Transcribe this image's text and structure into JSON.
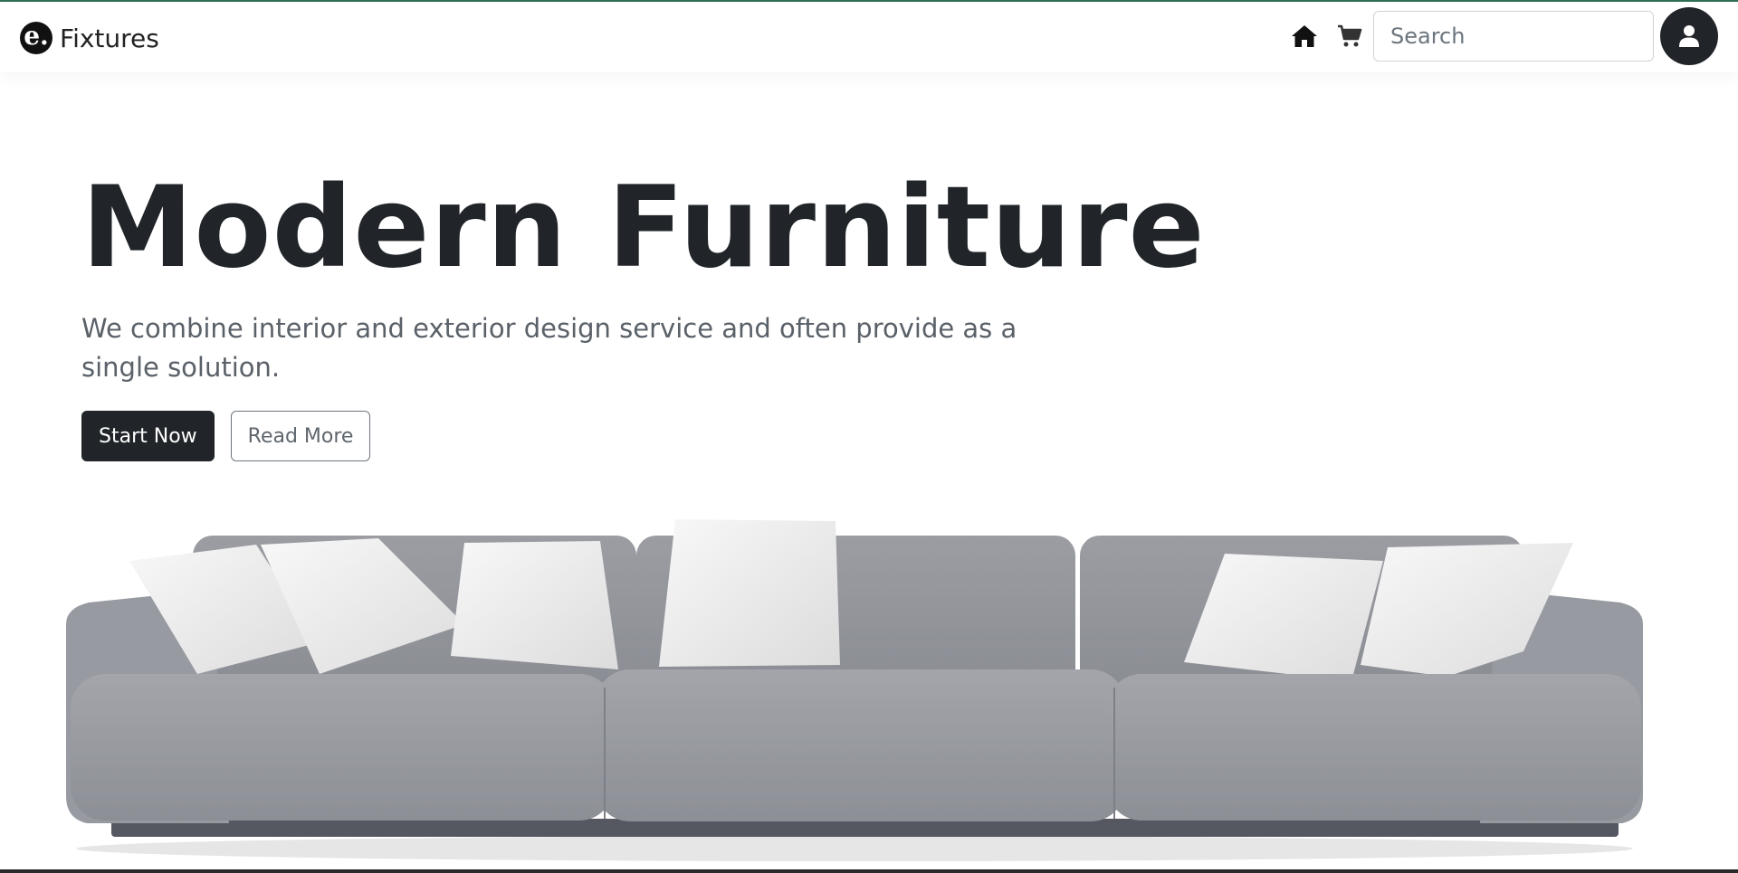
{
  "navbar": {
    "brand": {
      "logo_glyph": "e.",
      "name": "Fixtures"
    },
    "icons": {
      "home": "home-icon",
      "cart": "cart-icon",
      "user": "user-icon"
    },
    "search": {
      "placeholder": "Search",
      "value": ""
    }
  },
  "hero": {
    "title": "Modern Furniture",
    "subtitle": "We combine interior and exterior design service and often provide as a single solution.",
    "primary_button": "Start Now",
    "secondary_button": "Read More"
  },
  "colors": {
    "accent_dark": "#212529",
    "top_border": "#2f6f55",
    "sofa_gray": "#9a9ca3",
    "pillow_white": "#eeeeee"
  }
}
